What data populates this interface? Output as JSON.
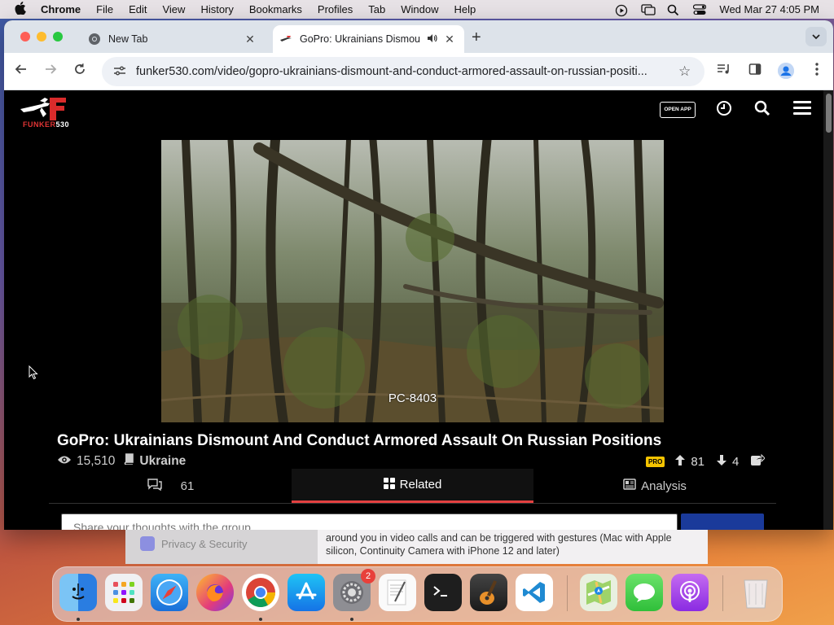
{
  "menubar": {
    "app_name": "Chrome",
    "items": [
      "File",
      "Edit",
      "View",
      "History",
      "Bookmarks",
      "Profiles",
      "Tab",
      "Window",
      "Help"
    ],
    "datetime": "Wed Mar 27  4:05 PM"
  },
  "browser": {
    "tabs": [
      {
        "title": "New Tab",
        "active": false
      },
      {
        "title": "GoPro: Ukrainians Dismou",
        "active": true
      }
    ],
    "url": "funker530.com/video/gopro-ukrainians-dismount-and-conduct-armored-assault-on-russian-positi..."
  },
  "site": {
    "logo_text_red": "FUNKER",
    "logo_text_white": "530",
    "open_app_label": "OPEN APP"
  },
  "video": {
    "caption": "PC-8403",
    "title": "GoPro: Ukrainians Dismount And Conduct Armored Assault On Russian Positions",
    "views": "15,510",
    "category": "Ukraine",
    "pro_badge": "PRO",
    "upvotes": "81",
    "downvotes": "4"
  },
  "page_tabs": {
    "comments_count": "61",
    "related_label": "Related",
    "analysis_label": "Analysis"
  },
  "comment": {
    "placeholder": "Share your thoughts with the group . . ."
  },
  "background_window": {
    "sidebar_item": "Privacy & Security",
    "text": "around you in video calls and can be triggered with gestures (Mac with Apple silicon, Continuity Camera with iPhone 12 and later)"
  },
  "dock": {
    "apps": [
      "Finder",
      "Launchpad",
      "Safari",
      "Firefox",
      "Chrome",
      "App Store",
      "System Settings",
      "TextEdit",
      "Terminal",
      "GarageBand",
      "Visual Studio Code",
      "Maps",
      "Messages",
      "Podcasts",
      "Trash"
    ],
    "settings_badge": "2"
  },
  "colors": {
    "accent_red": "#e34040",
    "pro_yellow": "#f5c400",
    "site_bg": "#000000"
  }
}
